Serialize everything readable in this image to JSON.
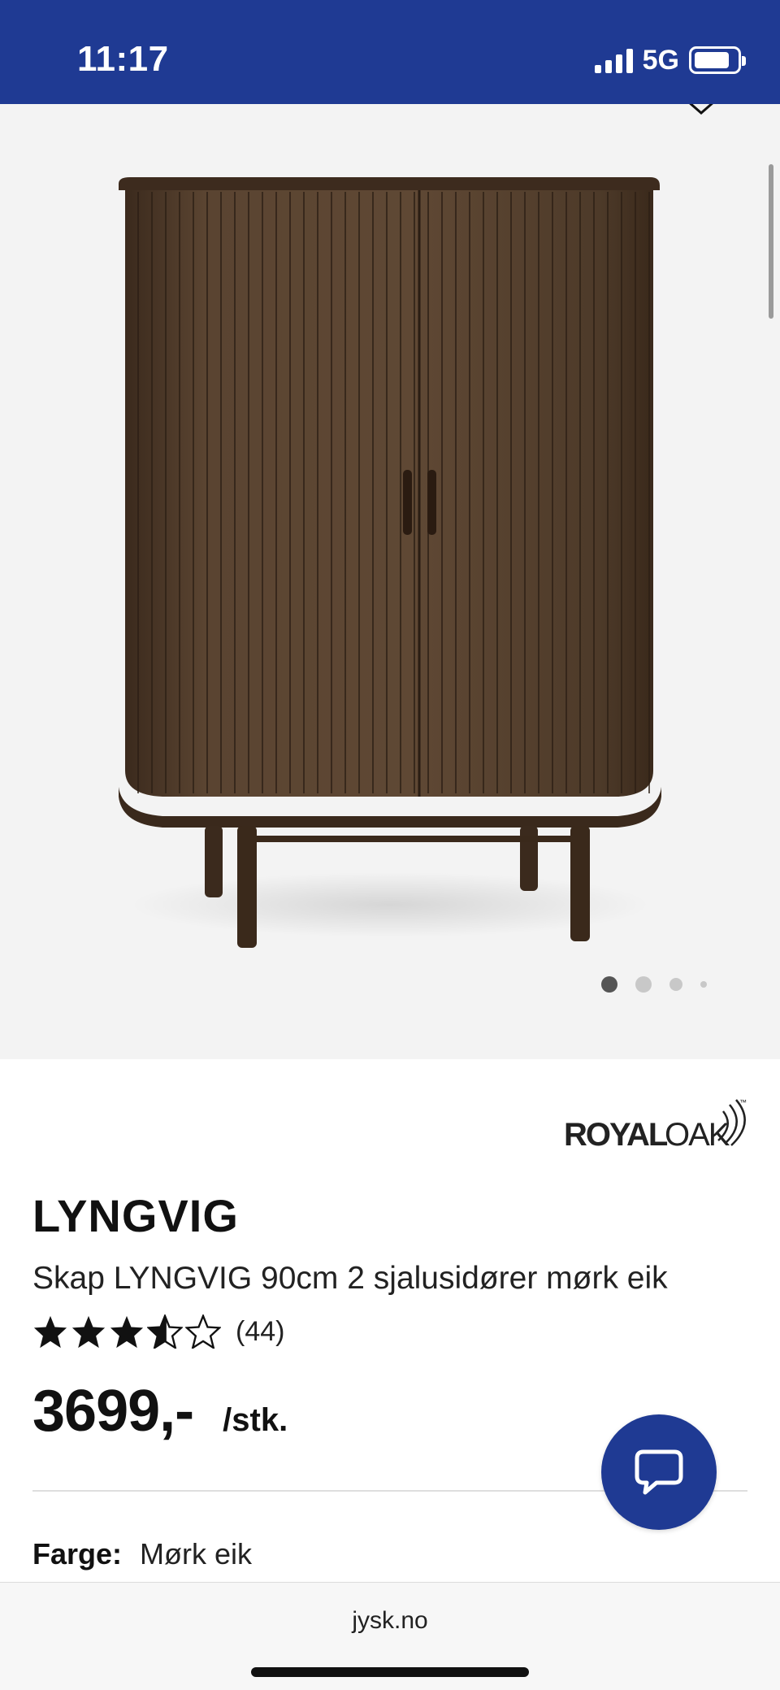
{
  "status_bar": {
    "time": "11:17",
    "network": "5G",
    "background": "#1f3a93"
  },
  "gallery": {
    "current_slide": 1,
    "slide_count": 4,
    "image_subject": "cabinet-image"
  },
  "brand": {
    "logo_text": "ROYALOAK",
    "logo_part1": "ROYAL",
    "logo_part2": "OAK",
    "trademark": "™"
  },
  "product": {
    "name": "LYNGVIG",
    "description": "Skap LYNGVIG 90cm 2 sjalusidører mørk eik",
    "rating": 3.5,
    "rating_max": 5,
    "review_count": "(44)",
    "price": "3699,-",
    "unit": "/stk.",
    "color_label": "Farge:",
    "color_value": "Mørk eik"
  },
  "chat": {
    "icon": "chat-bubble-icon",
    "color": "#1f3a93"
  },
  "browser": {
    "url": "jysk.no"
  }
}
